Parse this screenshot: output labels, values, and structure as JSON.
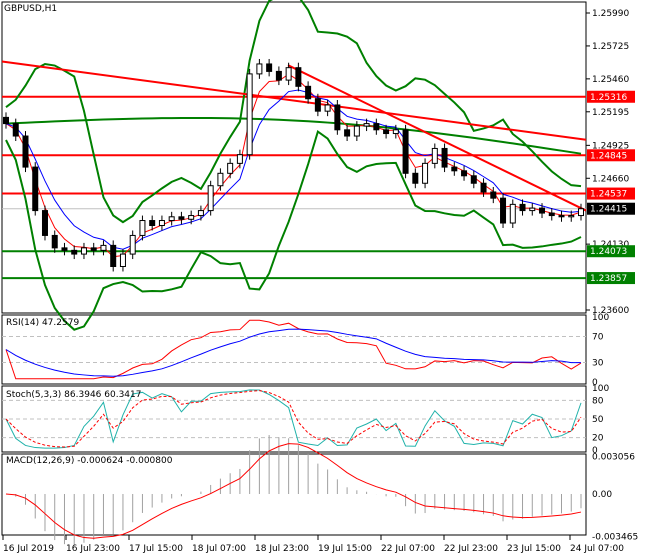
{
  "symbol_title": "GBPUSD,H1",
  "price_axis": [
    "1.25990",
    "1.25725",
    "1.25460",
    "1.25195",
    "1.24925",
    "1.24660",
    "1.24130",
    "1.23600"
  ],
  "levels": [
    {
      "price": 1.25316,
      "label": "1.25316",
      "color": "#ff0000"
    },
    {
      "price": 1.24845,
      "label": "1.24845",
      "color": "#ff0000"
    },
    {
      "price": 1.24537,
      "label": "1.24537",
      "color": "#ff0000"
    },
    {
      "price": 1.24073,
      "label": "1.24073",
      "color": "#008000"
    },
    {
      "price": 1.23857,
      "label": "1.23857",
      "color": "#008000"
    }
  ],
  "current_price": {
    "price": 1.24415,
    "label": "1.24415"
  },
  "time_axis": [
    "16 Jul 2019",
    "16 Jul 23:00",
    "17 Jul 15:00",
    "18 Jul 07:00",
    "18 Jul 23:00",
    "19 Jul 15:00",
    "22 Jul 07:00",
    "22 Jul 23:00",
    "23 Jul 15:00",
    "24 Jul 07:00"
  ],
  "rsi": {
    "title": "RSI(14) 47.2579",
    "axis": [
      "100",
      "70",
      "30",
      "0"
    ]
  },
  "stoch": {
    "title": "Stoch(5,3,3) 86.3946 60.3417",
    "axis": [
      "100",
      "80",
      "50",
      "20",
      "0"
    ]
  },
  "macd": {
    "title": "MACD(12,26,9) -0.000624 -0.000800",
    "axis": [
      "0.003056",
      "0.00",
      "-0.003465"
    ]
  },
  "chart_data": {
    "type": "candlestick",
    "closes": [
      1.251,
      1.25,
      1.2475,
      1.244,
      1.242,
      1.241,
      1.2408,
      1.2405,
      1.241,
      1.2408,
      1.2412,
      1.2395,
      1.2405,
      1.242,
      1.2432,
      1.2428,
      1.2432,
      1.2435,
      1.2433,
      1.2436,
      1.244,
      1.246,
      1.247,
      1.2478,
      1.2485,
      1.255,
      1.2558,
      1.2552,
      1.2545,
      1.2555,
      1.254,
      1.253,
      1.252,
      1.2525,
      1.2505,
      1.25,
      1.2508,
      1.251,
      1.2505,
      1.2502,
      1.2505,
      1.247,
      1.2462,
      1.2478,
      1.249,
      1.2475,
      1.2472,
      1.2468,
      1.2462,
      1.2455,
      1.245,
      1.243,
      1.2445,
      1.244,
      1.2442,
      1.2438,
      1.2436,
      1.2435,
      1.2436,
      1.24415
    ],
    "ylim": [
      1.236,
      1.2599
    ],
    "trendline": [
      1.2557,
      1.244
    ],
    "long_ma": [
      1.256,
      1.2497
    ]
  }
}
